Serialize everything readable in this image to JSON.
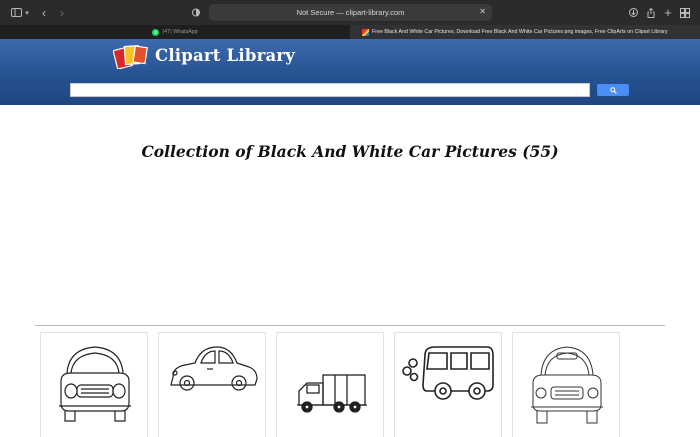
{
  "browser": {
    "address": "Not Secure — clipart-library.com",
    "tabs": [
      {
        "label": "(47) WhatsApp"
      },
      {
        "label": "Free Black And White Car Pictures, Download Free Black And White Car Pictures png images, Free ClipArts on Clipart Library"
      }
    ]
  },
  "site": {
    "logo_text": "Clipart Library",
    "search": {
      "value": "",
      "placeholder": ""
    }
  },
  "content": {
    "title": "Collection of Black And White Car Pictures (55)",
    "thumbnails": [
      {
        "icon": "car-front-icon"
      },
      {
        "icon": "car-side-icon"
      },
      {
        "icon": "truck-icon"
      },
      {
        "icon": "van-icon"
      },
      {
        "icon": "car-front-icon"
      }
    ]
  }
}
